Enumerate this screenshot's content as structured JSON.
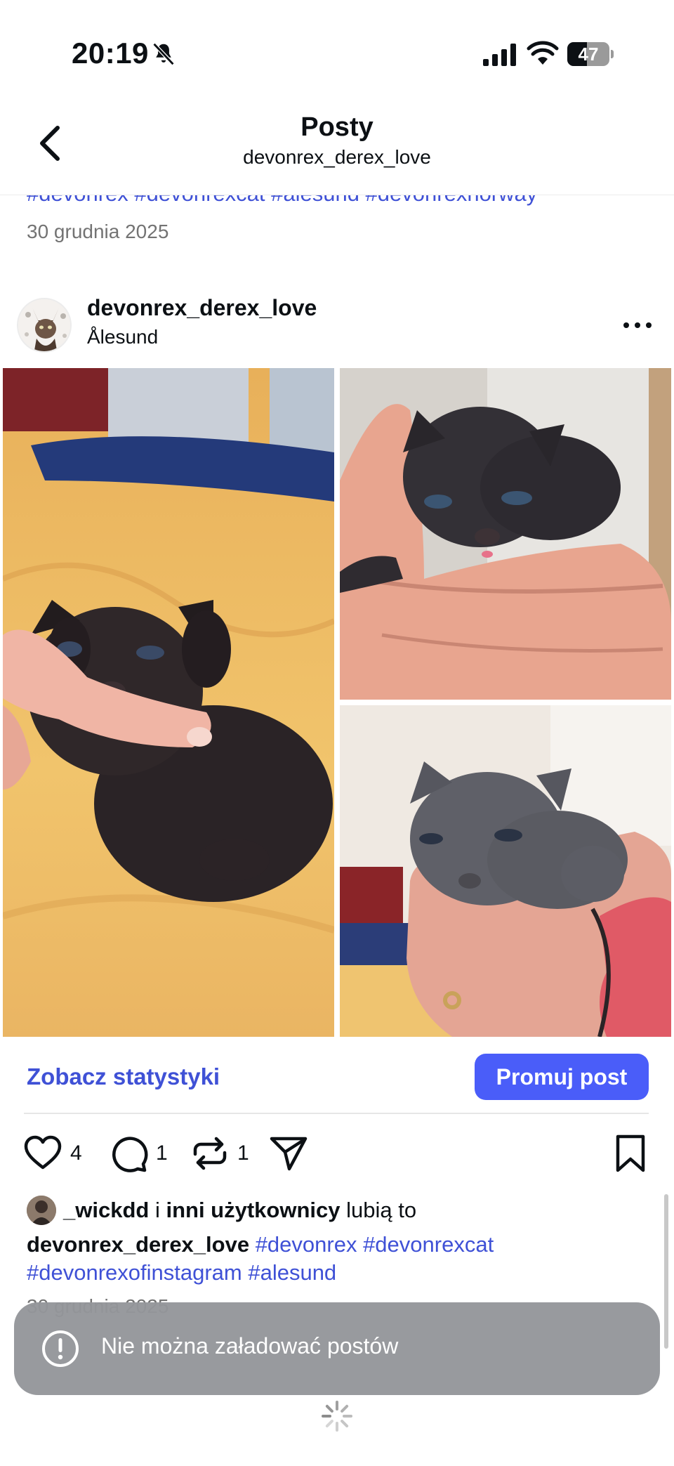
{
  "status_bar": {
    "time": "20:19",
    "battery": "47",
    "battery_level": 0.47
  },
  "nav": {
    "title": "Posty",
    "subtitle": "devonrex_derex_love"
  },
  "previous_post": {
    "hashtags": "#devonrex #devonrexcat #alesund #devonrexnorway",
    "date": "30 grudnia 2025"
  },
  "post": {
    "username": "devonrex_derex_love",
    "location": "Ålesund",
    "insights_link": "Zobacz statystyki",
    "promote_label": "Promuj post",
    "actions": {
      "likes": "4",
      "comments": "1",
      "reposts": "1"
    },
    "liked_by": {
      "first_user": "_wickdd",
      "connector": " i ",
      "others": "inni użytkownicy",
      "suffix": " lubią to"
    },
    "caption": {
      "author": "devonrex_derex_love",
      "hashtags_line1": " #devonrex #devonrexcat",
      "hashtags_line2": "#devonrexofinstagram #alesund"
    },
    "date": "30 grudnia 2025"
  },
  "toast": {
    "message": "Nie można załadować postów"
  }
}
